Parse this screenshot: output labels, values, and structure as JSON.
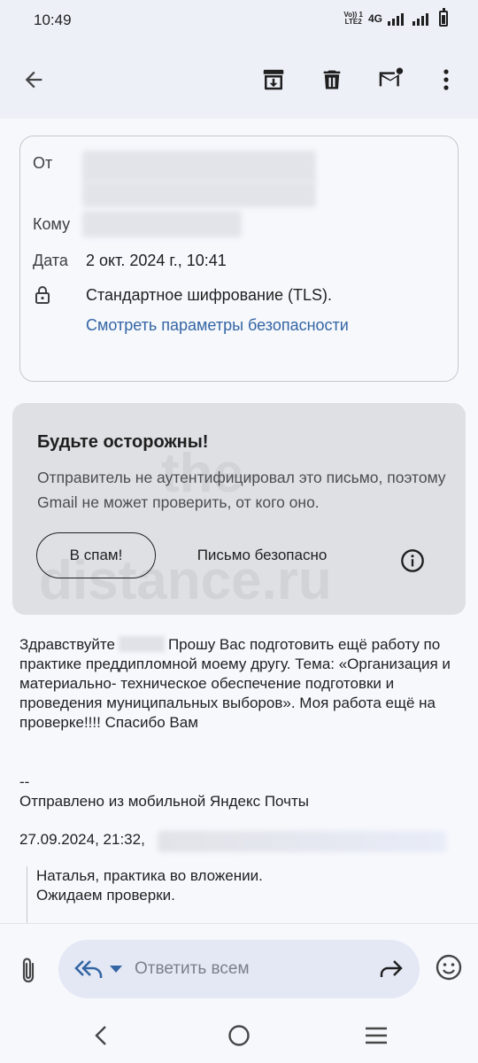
{
  "status_bar": {
    "time": "10:49",
    "volte_top": "Vo)) 1",
    "volte_bottom": "LTE2",
    "network": "4G"
  },
  "toolbar": {
    "back_icon": "arrow-back-icon",
    "archive_icon": "archive-icon",
    "delete_icon": "delete-icon",
    "mark_unread_icon": "mark-unread-icon",
    "more_icon": "more-vert-icon"
  },
  "header": {
    "from_label": "От",
    "to_label": "Кому",
    "date_label": "Дата",
    "date_value": "2 окт. 2024 г., 10:41",
    "encryption_text": "Стандартное шифрование (TLS).",
    "security_link": "Смотреть параметры безопасности"
  },
  "warning": {
    "title": "Будьте осторожны!",
    "text": "Отправитель не аутентифицировал это письмо, поэтому Gmail не может проверить, от кого оно.",
    "spam_button": "В спам!",
    "safe_button": "Письмо безопасно",
    "watermark_line1": "the-",
    "watermark_line2": "distance.ru"
  },
  "body": {
    "greeting": "Здравствуйте",
    "message": "Прошу Вас подготовить ещё работу по практике преддипломной моему другу. Тема: «Организация  и материально- техническое обеспечение подготовки и проведения муниципальных выборов».  Моя работа ещё на проверке!!!! Спасибо Вам",
    "signature_sep": "--",
    "signature": "Отправлено из мобильной Яндекс Почты",
    "quoted_header": "27.09.2024, 21:32,",
    "quoted_line1": "Наталья, практика во вложении.",
    "quoted_line2": "Ожидаем проверки."
  },
  "reply": {
    "placeholder": "Ответить всем"
  },
  "colors": {
    "accent": "#3465a4",
    "background": "#f6f8fc",
    "warning_bg": "#dfe0e4"
  }
}
